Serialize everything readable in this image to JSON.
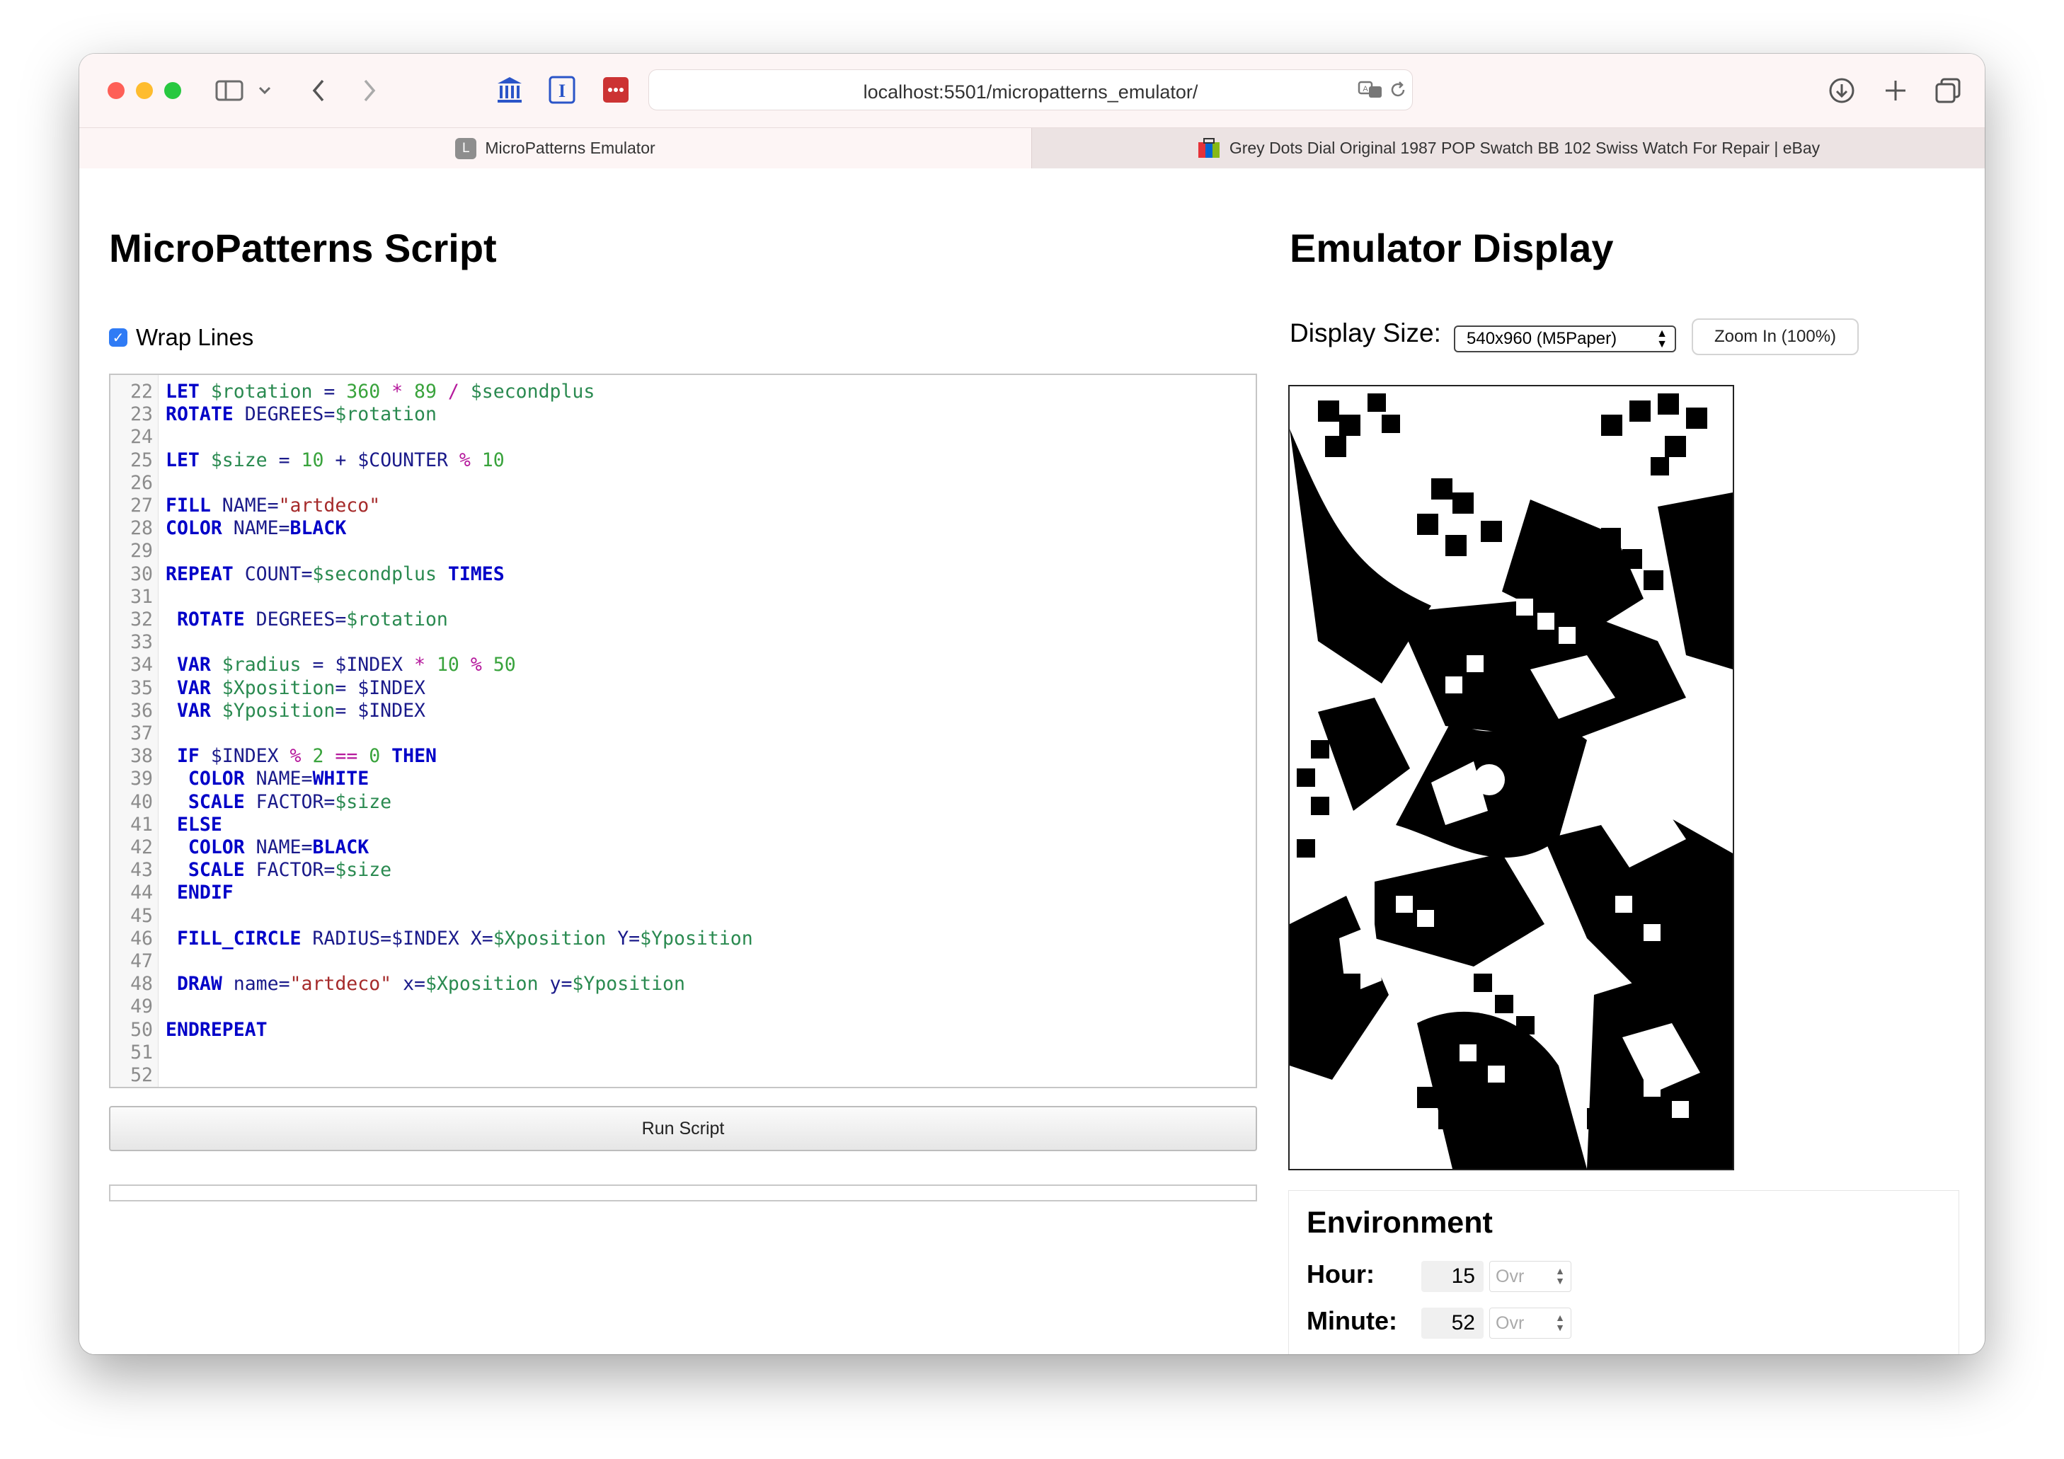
{
  "browser": {
    "url": "localhost:5501/micropatterns_emulator/",
    "tabs": [
      {
        "title": "MicroPatterns Emulator",
        "favicon_letter": "L"
      },
      {
        "title": "Grey Dots Dial Original 1987 POP Swatch BB 102 Swiss Watch For Repair | eBay"
      }
    ],
    "traffic_lights": {
      "close": "#fe5f57",
      "minimize": "#febc2e",
      "zoom": "#28c840"
    }
  },
  "script_panel": {
    "heading": "MicroPatterns Script",
    "wrap_lines_label": "Wrap Lines",
    "wrap_lines_checked": true,
    "run_button": "Run Script",
    "lines": [
      {
        "n": "22",
        "tokens": [
          [
            "kw",
            "LET "
          ],
          [
            "var",
            "$rotation"
          ],
          [
            "pl",
            " = "
          ],
          [
            "num",
            "360"
          ],
          [
            "op",
            " * "
          ],
          [
            "num",
            "89"
          ],
          [
            "op",
            " / "
          ],
          [
            "var",
            "$secondplus"
          ]
        ]
      },
      {
        "n": "23",
        "tokens": [
          [
            "kw",
            "ROTATE "
          ],
          [
            "pl",
            "DEGREES="
          ],
          [
            "var",
            "$rotation"
          ]
        ]
      },
      {
        "n": "24",
        "tokens": []
      },
      {
        "n": "25",
        "tokens": [
          [
            "kw",
            "LET "
          ],
          [
            "var",
            "$size"
          ],
          [
            "pl",
            " = "
          ],
          [
            "num",
            "10"
          ],
          [
            "pl",
            " + "
          ],
          [
            "pl",
            "$COUNTER"
          ],
          [
            "op",
            " % "
          ],
          [
            "num",
            "10"
          ]
        ]
      },
      {
        "n": "26",
        "tokens": []
      },
      {
        "n": "27",
        "tokens": [
          [
            "kw",
            "FILL "
          ],
          [
            "pl",
            "NAME="
          ],
          [
            "str",
            "\"artdeco\""
          ]
        ]
      },
      {
        "n": "28",
        "tokens": [
          [
            "kw",
            "COLOR "
          ],
          [
            "pl",
            "NAME="
          ],
          [
            "kw",
            "BLACK"
          ]
        ]
      },
      {
        "n": "29",
        "tokens": []
      },
      {
        "n": "30",
        "tokens": [
          [
            "kw",
            "REPEAT "
          ],
          [
            "pl",
            "COUNT="
          ],
          [
            "var",
            "$secondplus"
          ],
          [
            "kw",
            " TIMES"
          ]
        ]
      },
      {
        "n": "31",
        "tokens": []
      },
      {
        "n": "32",
        "tokens": [
          [
            "pl",
            " "
          ],
          [
            "kw",
            "ROTATE "
          ],
          [
            "pl",
            "DEGREES="
          ],
          [
            "var",
            "$rotation"
          ]
        ]
      },
      {
        "n": "33",
        "tokens": []
      },
      {
        "n": "34",
        "tokens": [
          [
            "pl",
            " "
          ],
          [
            "kw",
            "VAR "
          ],
          [
            "var",
            "$radius"
          ],
          [
            "pl",
            " = "
          ],
          [
            "pl",
            "$INDEX"
          ],
          [
            "op",
            " * "
          ],
          [
            "num",
            "10"
          ],
          [
            "op",
            " % "
          ],
          [
            "num",
            "50"
          ]
        ]
      },
      {
        "n": "35",
        "tokens": [
          [
            "pl",
            " "
          ],
          [
            "kw",
            "VAR "
          ],
          [
            "var",
            "$Xposition"
          ],
          [
            "pl",
            "= "
          ],
          [
            "pl",
            "$INDEX"
          ]
        ]
      },
      {
        "n": "36",
        "tokens": [
          [
            "pl",
            " "
          ],
          [
            "kw",
            "VAR "
          ],
          [
            "var",
            "$Yposition"
          ],
          [
            "pl",
            "= "
          ],
          [
            "pl",
            "$INDEX"
          ]
        ]
      },
      {
        "n": "37",
        "tokens": []
      },
      {
        "n": "38",
        "tokens": [
          [
            "pl",
            " "
          ],
          [
            "kw",
            "IF "
          ],
          [
            "pl",
            "$INDEX"
          ],
          [
            "op",
            " % "
          ],
          [
            "num",
            "2"
          ],
          [
            "op",
            " == "
          ],
          [
            "num",
            "0"
          ],
          [
            "kw",
            " THEN"
          ]
        ]
      },
      {
        "n": "39",
        "tokens": [
          [
            "pl",
            "  "
          ],
          [
            "kw",
            "COLOR "
          ],
          [
            "pl",
            "NAME="
          ],
          [
            "kw",
            "WHITE"
          ]
        ]
      },
      {
        "n": "40",
        "tokens": [
          [
            "pl",
            "  "
          ],
          [
            "kw",
            "SCALE "
          ],
          [
            "pl",
            "FACTOR="
          ],
          [
            "var",
            "$size"
          ]
        ]
      },
      {
        "n": "41",
        "tokens": [
          [
            "pl",
            " "
          ],
          [
            "kw",
            "ELSE"
          ]
        ]
      },
      {
        "n": "42",
        "tokens": [
          [
            "pl",
            "  "
          ],
          [
            "kw",
            "COLOR "
          ],
          [
            "pl",
            "NAME="
          ],
          [
            "kw",
            "BLACK"
          ]
        ]
      },
      {
        "n": "43",
        "tokens": [
          [
            "pl",
            "  "
          ],
          [
            "kw",
            "SCALE "
          ],
          [
            "pl",
            "FACTOR="
          ],
          [
            "var",
            "$size"
          ]
        ]
      },
      {
        "n": "44",
        "tokens": [
          [
            "pl",
            " "
          ],
          [
            "kw",
            "ENDIF"
          ]
        ]
      },
      {
        "n": "45",
        "tokens": []
      },
      {
        "n": "46",
        "tokens": [
          [
            "pl",
            " "
          ],
          [
            "kw",
            "FILL_CIRCLE "
          ],
          [
            "pl",
            "RADIUS="
          ],
          [
            "pl",
            "$INDEX"
          ],
          [
            "pl",
            " X="
          ],
          [
            "var",
            "$Xposition"
          ],
          [
            "pl",
            " Y="
          ],
          [
            "var",
            "$Yposition"
          ]
        ]
      },
      {
        "n": "47",
        "tokens": []
      },
      {
        "n": "48",
        "tokens": [
          [
            "pl",
            " "
          ],
          [
            "kw",
            "DRAW "
          ],
          [
            "pl",
            "name="
          ],
          [
            "str",
            "\"artdeco\""
          ],
          [
            "pl",
            " x="
          ],
          [
            "var",
            "$Xposition"
          ],
          [
            "pl",
            " y="
          ],
          [
            "var",
            "$Yposition"
          ]
        ]
      },
      {
        "n": "49",
        "tokens": []
      },
      {
        "n": "50",
        "tokens": [
          [
            "kw",
            "ENDREPEAT"
          ]
        ]
      },
      {
        "n": "51",
        "tokens": []
      },
      {
        "n": "52",
        "tokens": []
      }
    ]
  },
  "display_panel": {
    "heading": "Emulator Display",
    "display_size_label": "Display Size:",
    "display_size_value": "540x960 (M5Paper)",
    "zoom_button": "Zoom In (100%)"
  },
  "environment": {
    "heading": "Environment",
    "rows": [
      {
        "label": "Hour:",
        "value": "15",
        "override_placeholder": "Ovr"
      },
      {
        "label": "Minute:",
        "value": "52",
        "override_placeholder": "Ovr"
      }
    ]
  }
}
